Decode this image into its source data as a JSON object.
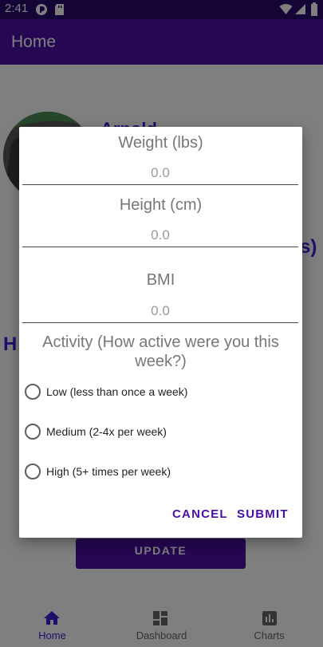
{
  "status_bar": {
    "time": "2:41"
  },
  "app_bar": {
    "title": "Home"
  },
  "background": {
    "name_partial": "Arnold",
    "partial_right": "s)",
    "partial_left": "H",
    "update_label": "UPDATE"
  },
  "bottom_nav": {
    "items": [
      {
        "label": "Home",
        "icon": "home-icon",
        "active": true
      },
      {
        "label": "Dashboard",
        "icon": "dashboard-icon",
        "active": false
      },
      {
        "label": "Charts",
        "icon": "chart-icon",
        "active": false
      }
    ]
  },
  "dialog": {
    "weight_label": "Weight (lbs)",
    "weight_placeholder": "0.0",
    "height_label": "Height (cm)",
    "height_placeholder": "0.0",
    "bmi_label": "BMI",
    "bmi_placeholder": "0.0",
    "activity_title": "Activity (How active were you this week?)",
    "options": [
      "Low (less than once a week)",
      "Medium (2-4x per week)",
      "High (5+ times per week)"
    ],
    "cancel_label": "CANCEL",
    "submit_label": "SUBMIT"
  },
  "colors": {
    "primary": "#4a0ea6",
    "status_bar": "#2a0a6e",
    "accent_text": "#3f1dd8"
  }
}
